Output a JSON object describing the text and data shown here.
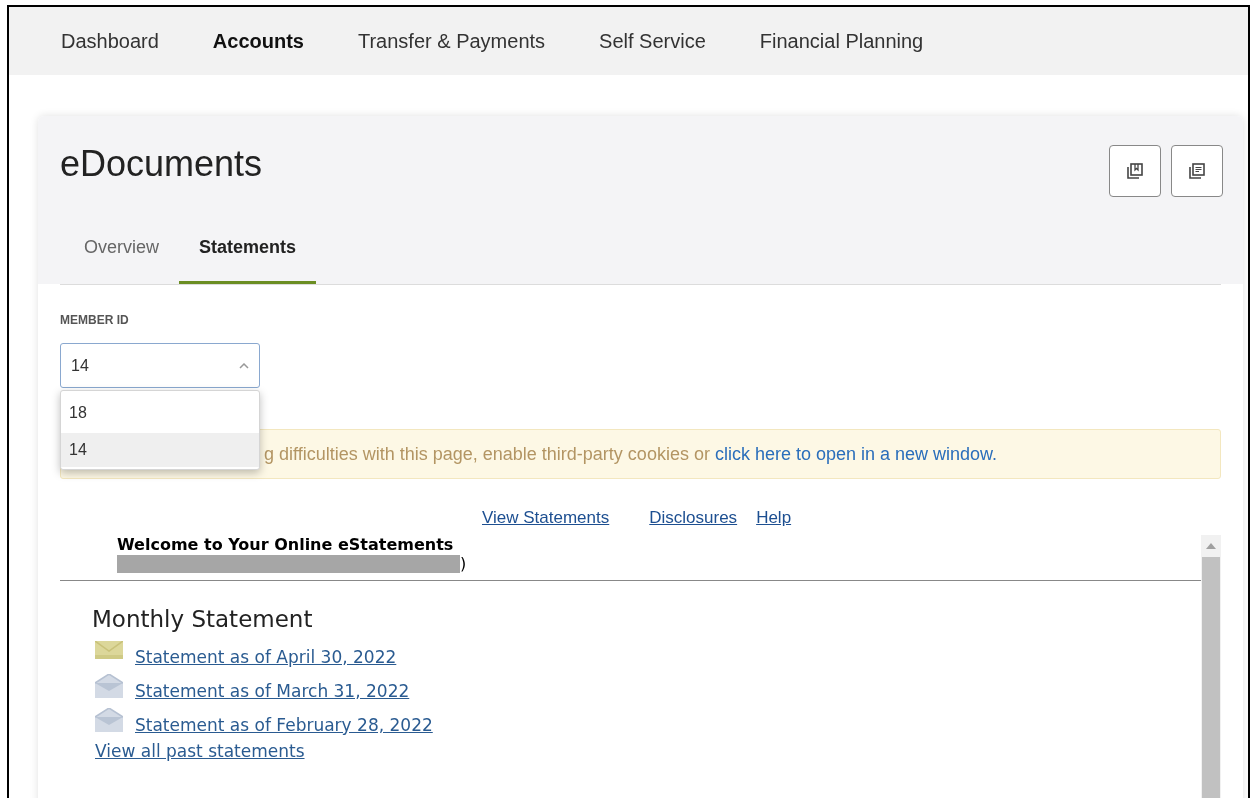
{
  "nav": [
    {
      "label": "Dashboard",
      "selected": false
    },
    {
      "label": "Accounts",
      "selected": true
    },
    {
      "label": "Transfer & Payments",
      "selected": false
    },
    {
      "label": "Self Service",
      "selected": false
    },
    {
      "label": "Financial Planning",
      "selected": false
    }
  ],
  "page_title": "eDocuments",
  "header_buttons": [
    {
      "kind": "bookmark"
    },
    {
      "kind": "document"
    }
  ],
  "tabs": [
    {
      "label": "Overview",
      "selected": false
    },
    {
      "label": "Statements",
      "selected": true
    }
  ],
  "member_id": {
    "label": "MEMBER ID",
    "value": "14",
    "expanded": true,
    "options": [
      {
        "label": "18",
        "selected": false
      },
      {
        "label": "14",
        "selected": true
      }
    ]
  },
  "notice": {
    "text": "g difficulties with this page, enable third-party cookies or ",
    "link": "click here to open in a new window."
  },
  "links": [
    "View Statements",
    "Disclosures",
    "Help"
  ],
  "welcome": {
    "title": "Welcome to Your Online eStatements",
    "subtitle_end": ")"
  },
  "monthly": {
    "title": "Monthly Statement",
    "statements": [
      {
        "label": "Statement as of April 30, 2022",
        "unread": true
      },
      {
        "label": "Statement as of March 31, 2022",
        "unread": false
      },
      {
        "label": "Statement as of February 28, 2022",
        "unread": false
      }
    ],
    "view_all": "View all past statements"
  }
}
